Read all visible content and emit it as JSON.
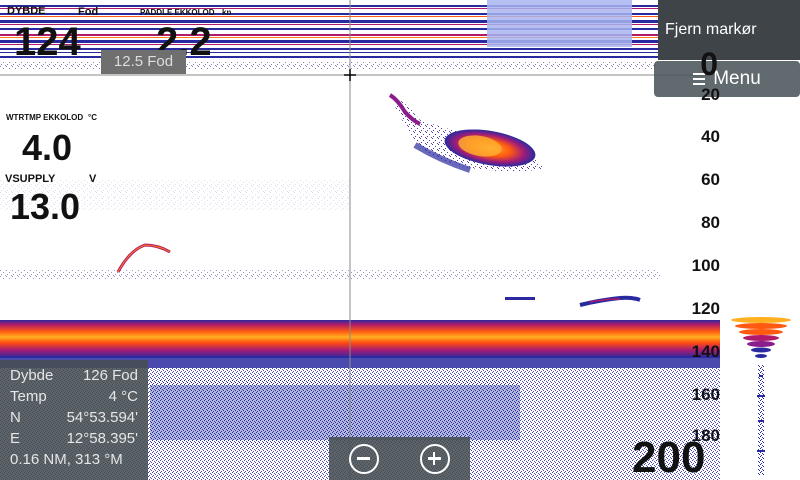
{
  "data_bar": {
    "depth": {
      "label": "DYBDE",
      "unit": "Fod",
      "value": "124"
    },
    "speed": {
      "label": "PADDLE EKKOLOD",
      "unit": "kn",
      "value": "2.2"
    }
  },
  "range_pill": "12.5 Fod",
  "water_temp": {
    "label": "WTRTMP EKKOLOD",
    "unit": "°C",
    "value": "4.0"
  },
  "supply_voltage": {
    "label": "VSUPPLY",
    "unit": "V",
    "value": "13.0"
  },
  "buttons": {
    "remove_marker": "Fjern markør",
    "menu": "Menu"
  },
  "depth_scale": [
    "0",
    "20",
    "40",
    "60",
    "80",
    "100",
    "120",
    "140",
    "160",
    "180"
  ],
  "range_max": "200",
  "cursor_info": {
    "rows": [
      {
        "key": "Dybde",
        "value": "126 Fod"
      },
      {
        "key": "Temp",
        "value": "4   °C"
      },
      {
        "key": "N",
        "value": "54°53.594'"
      },
      {
        "key": "E",
        "value": "12°58.395'"
      },
      {
        "key": "0.16 NM, 313 °M",
        "value": ""
      }
    ]
  },
  "zoom": {
    "out_icon": "zoom-out-icon",
    "in_icon": "zoom-in-icon"
  },
  "colors": {
    "panel": "#464e52",
    "bottom_hot": "#ff3b00",
    "bottom_warm": "#ffb020",
    "echo_blue": "#1a2aa0",
    "echo_purple": "#8a1d8c"
  }
}
